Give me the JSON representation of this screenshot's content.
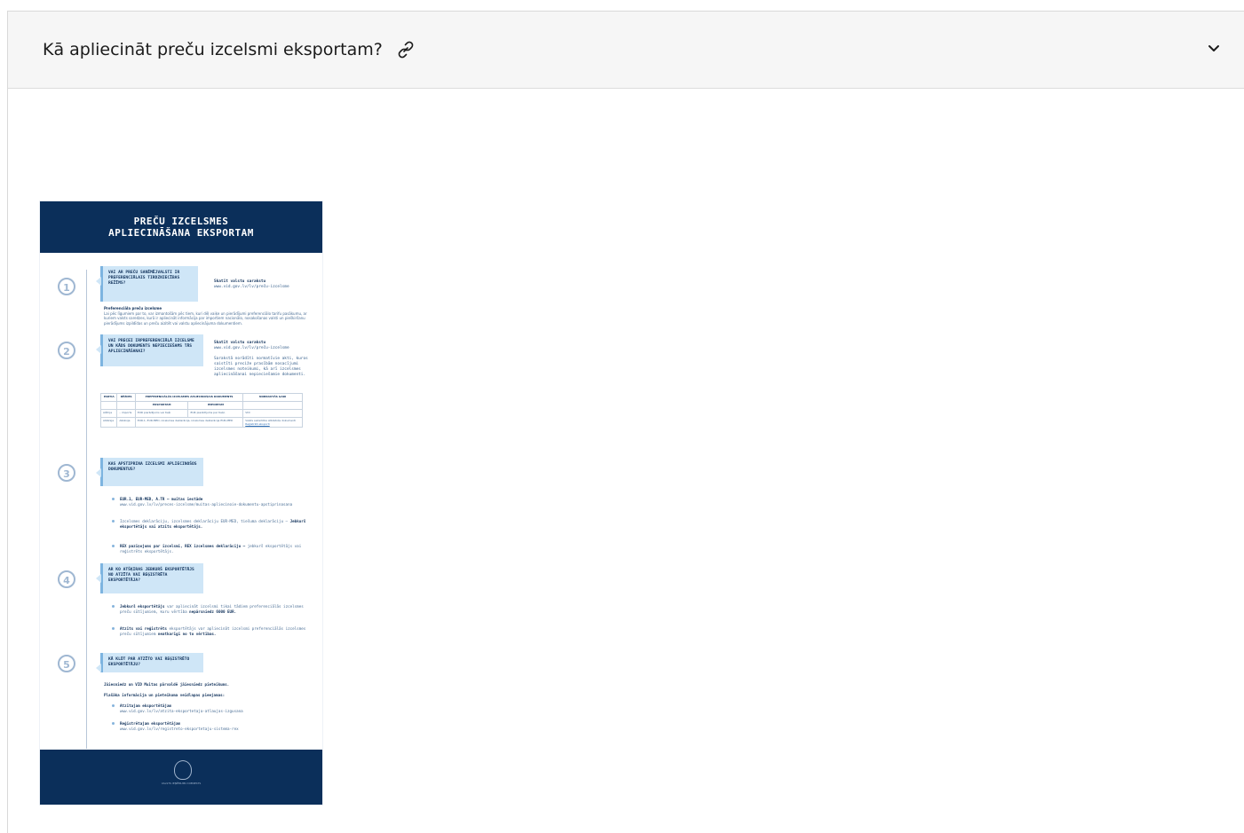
{
  "accordion": {
    "title": "Kā apliecināt preču izcelsmi eksportam?",
    "link_icon": "link-icon",
    "chevron_icon": "chevron-down-icon"
  },
  "poster": {
    "header_line1": "PREČU IZCELSMES",
    "header_line2": "APLIECINĀŠANA EKSPORTAM",
    "steps": [
      "1",
      "2",
      "3",
      "4",
      "5"
    ],
    "q1": {
      "title": "VAI AR PREČU SANĒMĒJVALSTI IR PREFERENCIĀLAIS TIRDZNIECĪBAS REŽĪMS?",
      "side_title": "Skatīt valstu sarakstu",
      "side_url": "www.vid.gov.lv/lv/preču-izcelsme",
      "sub_title": "Preferenciāla preču izcelsme",
      "sub_text": "Lai pēc līgumiem par to, var izmantošām pēc tiem, kuri dēļ vaiķe un pierādījumi preferenciālo tarifu pasākumu, ar kuriem valsts saredzes, kurā ir apliecināt informācija par importiem nacionālo, nosakošanas valsti un pieškiršanu pierādījums izpildīdas un preču aizitēt vai valstu apliecinājuma dokumentiem."
    },
    "q2": {
      "title": "VAI PRECEI IRPREFERENCIĀLĀ IZCELSME UN KĀDS DOKUMENTS NEPIECIEŠAMS TĀS APLIECINĀŠANAI?",
      "side_title": "Skatīt valstu sarakstu",
      "side_url": "www.vid.gov.lv/lv/preču-izcelsme",
      "side_text": "Sarakstā norādīti normatīvie akti, kuros saistīti preciže prasībām nosacījumi izcelsmes noteikumi, kā arī izcelsmes apliecināšanai nepieciešamie dokumenti."
    },
    "table": {
      "headers": [
        "PARTIA",
        "RĒŽIMS",
        "PREFERENCIĀLĀS IZCELSMES APLIECINOŠAIS DOKUMENTS",
        "NOBRAUTĀS GADI"
      ],
      "subheaders": [
        "EKSPORTAM",
        "IMPORTAM"
      ],
      "rows": [
        [
          "Alžīrija",
          "– imports",
          "EUR pierādījums vai tieši",
          "EUR pierādījums par tiešo",
          "VDI"
        ],
        [
          "Albānija",
          "Albānija",
          "EUR.1, EUR-MED, izcelsmes deklarācija, izcelsmes deklarācija EUR-MED",
          "",
          "Valsts sadarbība atbilstošs dokumenti"
        ]
      ],
      "link": "Reģistrēti eksporti"
    },
    "q3": {
      "title": "KAS APSTIPRINA IZCELSMI APLIECINOŠOS DOKUMENTUS?",
      "b1_bold": "EUR.1, EUR-MED, A.TR – muitas iestāde",
      "b1_text": "www.vid.gov.lv/lv/preces-izcelsme/muitas-apliecinoie-dokumentu-apstiprinasana",
      "b2_text": "Izcelsmes deklarāciju, izcelsmes deklarāciju EUR-MED, tiešuma deklarāciju –",
      "b2_bold": "Jebkurš eksportētājs vai atzīts eksportētājs.",
      "b3_bold": "REX paziņojums par izcelsmi, REX izcelsmes deklarāciju –",
      "b3_text": "jebkurš eksportētājs vai reģistrēts eksportētājs."
    },
    "q4": {
      "title": "AR KO ATŠĶIRAS JEBKURŠ EKSPORTĒTĀJS NO ATZĪTA VAI REĢISTRĒTA EKSPORTĒTĀJA?",
      "b1_bold": "Jebkurš eksportētājs",
      "b1_text": "var apliecināt izcelsmi tikai tādiem preferenciālās izcelsmes preču sūtījumiem, kuru vērtība",
      "b1_end": "nepārsniedz 6000 EUR.",
      "b2_bold": "Atzīts vai reģistrēts",
      "b2_text": "eksportētājs var apliecināt izcelsmi preferenciālās izcelsmes preču sūtījumiem",
      "b2_end": "neatkarīgi no to vērtības."
    },
    "q5": {
      "title": "KĀ KLŪT PAR ATZĪTO VAI REĢISTRĒTO EKSPORTĒTĀJU?",
      "line1": "Jāiesniedz un VID Muitas pārvaldē jāiesniedz pieteikums.",
      "line2": "Plašāka informācija un pieteikuma veidlapas pieejamas:",
      "b1_bold": "Atzītajam eksportētājam",
      "b1_url": "www.vid.gov.lv/lv/atzita-eksportetaja-atlaujas-izgusana",
      "b2_bold": "Reģistrētajam eksportētājam",
      "b2_url": "www.vid.gov.lv/lv/registreto-eksportetaju-sistema-rex"
    },
    "footer_text": "VALSTS IEŅĒMUMU DIENESTS",
    "footer_icon": "crest-icon"
  }
}
